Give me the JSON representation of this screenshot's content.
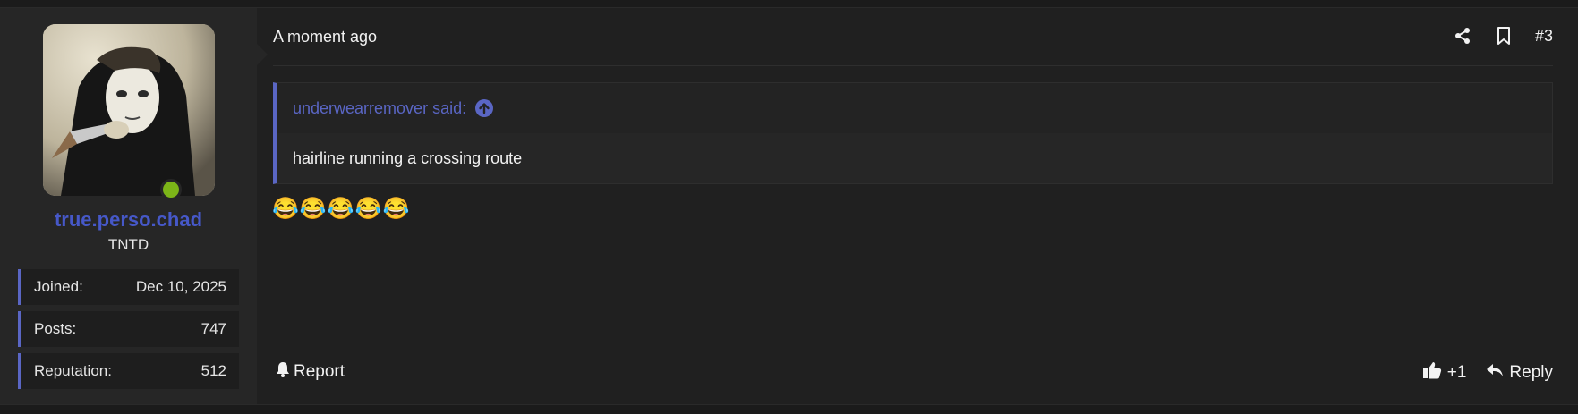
{
  "user": {
    "name": "true.perso.chad",
    "title": "TNTD",
    "name_color": "#4658c8",
    "online_color": "#7cb518",
    "stats": [
      {
        "label": "Joined:",
        "value": "Dec 10, 2025"
      },
      {
        "label": "Posts:",
        "value": "747"
      },
      {
        "label": "Reputation:",
        "value": "512"
      }
    ]
  },
  "post": {
    "time": "A moment ago",
    "number": "#3",
    "quote": {
      "author_line": "underwearremover said:",
      "text": "hairline running a crossing route"
    },
    "body": "😂😂😂😂😂",
    "footer": {
      "report_label": "Report",
      "like_label": "+1",
      "reply_label": "Reply"
    }
  },
  "icons": {
    "share": "share-icon",
    "bookmark": "bookmark-icon",
    "goto": "arrow-up-circle-icon",
    "report": "bell-icon",
    "like": "thumbs-up-icon",
    "reply": "reply-arrow-icon"
  },
  "accent_color": "#5a66c4"
}
